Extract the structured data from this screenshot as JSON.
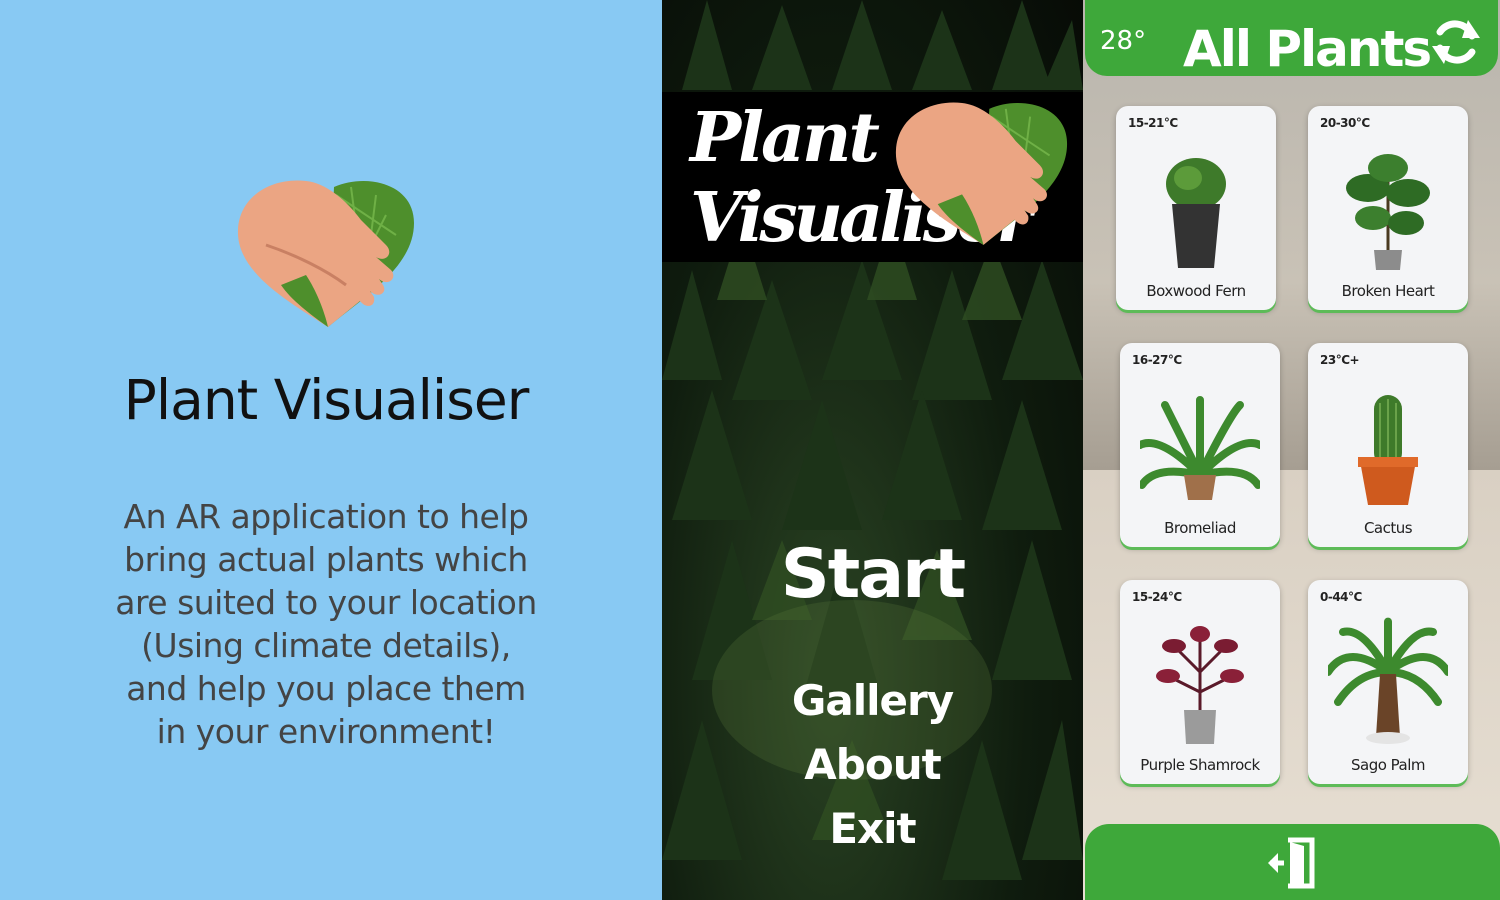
{
  "info": {
    "title": "Plant Visualiser",
    "description": "An AR application to help bring actual plants which are suited to your location (Using climate details), and help you place them in your environment!"
  },
  "menu": {
    "brand_line1": "Plant",
    "brand_line2": "Visualiser",
    "start": "Start",
    "gallery": "Gallery",
    "about": "About",
    "exit": "Exit"
  },
  "plants": {
    "temperature": "28°",
    "title": "All Plants",
    "refresh_icon": "refresh-icon",
    "exit_icon": "exit-door-icon",
    "cards": [
      {
        "range": "15-21°C",
        "name": "Boxwood Fern"
      },
      {
        "range": "20-30°C",
        "name": "Broken Heart"
      },
      {
        "range": "16-27°C",
        "name": "Bromeliad"
      },
      {
        "range": "23°C+",
        "name": "Cactus"
      },
      {
        "range": "15-24°C",
        "name": "Purple Shamrock"
      },
      {
        "range": "0-44°C",
        "name": "Sago Palm"
      }
    ]
  },
  "colors": {
    "info_bg": "#88c9f3",
    "accent_green": "#3ea83a",
    "hand_skin": "#eba583",
    "leaf_green": "#4e8f2c"
  }
}
